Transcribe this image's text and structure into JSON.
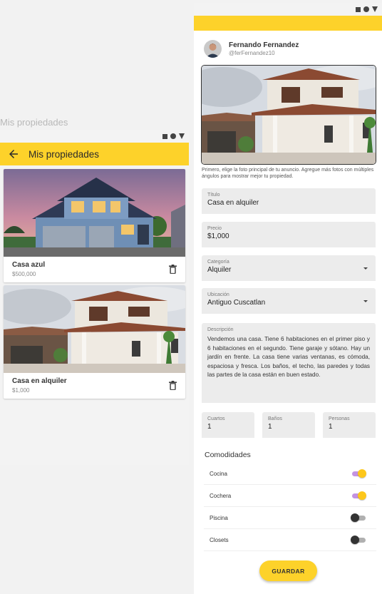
{
  "left": {
    "caption": "Mis propiedades",
    "appbar_title": "Mis propiedades",
    "cards": [
      {
        "title": "Casa azul",
        "price": "$500,000"
      },
      {
        "title": "Casa en alquiler",
        "price": "$1,000"
      }
    ]
  },
  "right": {
    "user": {
      "name": "Fernando Fernandez",
      "handle": "@ferFernandez10"
    },
    "hint": "Primero, elige la foto principal de tu anuncio. Agregue más fotos con múltiples ángulos para mostrar mejor tu propiedad.",
    "fields": {
      "titulo": {
        "label": "Título",
        "value": "Casa en alquiler"
      },
      "precio": {
        "label": "Precio",
        "value": "$1,000"
      },
      "categoria": {
        "label": "Categoría",
        "value": "Alquiler"
      },
      "ubicacion": {
        "label": "Ubicación",
        "value": "Antiguo Cuscatlan"
      },
      "descripcion": {
        "label": "Descripción",
        "value": "Vendemos una casa. Tiene 6 habitaciones en el primer piso y 6 habitaciones en el segundo. Tiene garaje y sótano. Hay un jardín en frente. La casa tiene varias ventanas, es cómoda, espaciosa y fresca. Los baños, el techo, las paredes y todas las partes de la casa están en buen estado."
      },
      "cuartos": {
        "label": "Cuartos",
        "value": "1"
      },
      "banos": {
        "label": "Baños",
        "value": "1"
      },
      "personas": {
        "label": "Personas",
        "value": "1"
      }
    },
    "amenities_title": "Comodidades",
    "amenities": [
      {
        "label": "Cocina",
        "on": true
      },
      {
        "label": "Cochera",
        "on": true
      },
      {
        "label": "Piscina",
        "on": false
      },
      {
        "label": "Closets",
        "on": false
      }
    ],
    "save_label": "GUARDAR"
  },
  "colors": {
    "accent": "#fdd22a",
    "toggle_track_on": "#c493e2",
    "toggle_thumb_on": "#fdc71b"
  }
}
